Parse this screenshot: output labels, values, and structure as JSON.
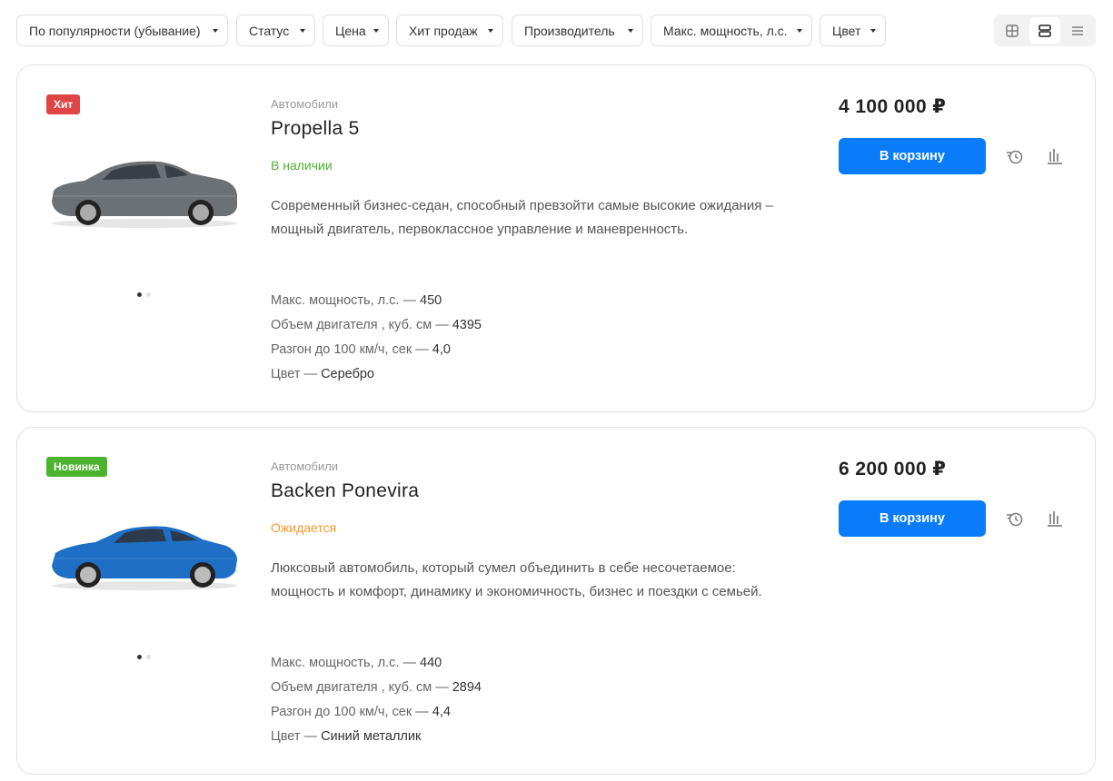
{
  "filters": [
    {
      "label": "По популярности (убывание)"
    },
    {
      "label": "Статус"
    },
    {
      "label": "Цена"
    },
    {
      "label": "Хит продаж"
    },
    {
      "label": "Производитель"
    },
    {
      "label": "Макс. мощность, л.с."
    },
    {
      "label": "Цвет"
    }
  ],
  "view_mode": "list-cards",
  "products": [
    {
      "badge": "Хит",
      "badge_color": "#e04545",
      "category": "Автомобили",
      "title": "Propella 5",
      "status": "В наличии",
      "status_color": "#4cb32f",
      "description": "Современный бизнес-седан, способный превзойти самые высокие ожидания – мощный двигатель, первоклассное управление и маневренность.",
      "image": "car-sedan-grey",
      "car_color": "#6c7176",
      "props": [
        {
          "name": "Макс. мощность, л.с.",
          "value": "450"
        },
        {
          "name": "Объем двигателя , куб. см",
          "value": "4395"
        },
        {
          "name": "Разгон до 100 км/ч, сек",
          "value": "4,0"
        },
        {
          "name": "Цвет",
          "value": "Серебро"
        }
      ],
      "price": "4 100 000 ₽",
      "cart_label": "В корзину"
    },
    {
      "badge": "Новинка",
      "badge_color": "#4cb32f",
      "category": "Автомобили",
      "title": "Backen Ponevira",
      "status": "Ожидается",
      "status_color": "#f59a2a",
      "description": "Люксовый автомобиль, который сумел объединить в себе несочетаемое: мощность и комфорт, динамику и экономичность, бизнес и поездки с семьей.",
      "image": "car-sport-blue",
      "car_color": "#1f6fc6",
      "props": [
        {
          "name": "Макс. мощность, л.с.",
          "value": "440"
        },
        {
          "name": "Объем двигателя , куб. см",
          "value": "2894"
        },
        {
          "name": "Разгон до 100 км/ч, сек",
          "value": "4,4"
        },
        {
          "name": "Цвет",
          "value": "Синий металлик"
        }
      ],
      "price": "6 200 000 ₽",
      "cart_label": "В корзину"
    }
  ]
}
